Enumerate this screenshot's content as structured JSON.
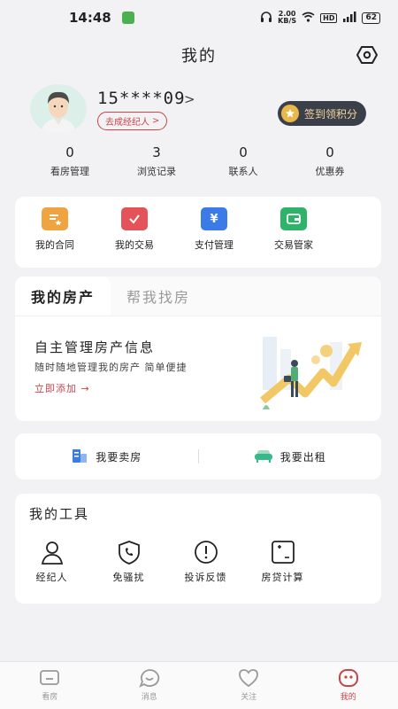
{
  "status_bar": {
    "time": "14:48",
    "speed_value": "2.00",
    "speed_unit": "KB/S",
    "hd": "HD",
    "network": "4G",
    "battery": "62"
  },
  "header": {
    "title": "我的"
  },
  "profile": {
    "phone": "15****09",
    "role": "去成经纪人",
    "checkin": "签到领积分"
  },
  "stats": [
    {
      "value": "0",
      "label": "看房管理"
    },
    {
      "value": "3",
      "label": "浏览记录"
    },
    {
      "value": "0",
      "label": "联系人"
    },
    {
      "value": "0",
      "label": "优惠券"
    }
  ],
  "quick_actions": [
    {
      "label": "我的合同",
      "icon": "contract-icon",
      "color": "#f0a441"
    },
    {
      "label": "我的交易",
      "icon": "trade-icon",
      "color": "#e4525a"
    },
    {
      "label": "支付管理",
      "icon": "payment-icon",
      "color": "#3b7be8"
    },
    {
      "label": "交易管家",
      "icon": "wallet-icon",
      "color": "#2fb36a"
    }
  ],
  "property": {
    "tabs": [
      "我的房产",
      "帮我找房"
    ],
    "title": "自主管理房产信息",
    "description": "随时随地管理我的房产 简单便捷",
    "add_link": "立即添加 →"
  },
  "sell_rent": {
    "sell": "我要卖房",
    "rent": "我要出租"
  },
  "tools": {
    "title": "我的工具",
    "items": [
      "经纪人",
      "免骚扰",
      "投诉反馈",
      "房贷计算"
    ]
  },
  "bottom_nav": {
    "items": [
      "看房",
      "消息",
      "关注",
      "我的"
    ],
    "active_index": 3
  },
  "colors": {
    "accent": "#c7454c",
    "checkin_bg": "#3b3f4a",
    "checkin_text": "#f1d9a0"
  }
}
